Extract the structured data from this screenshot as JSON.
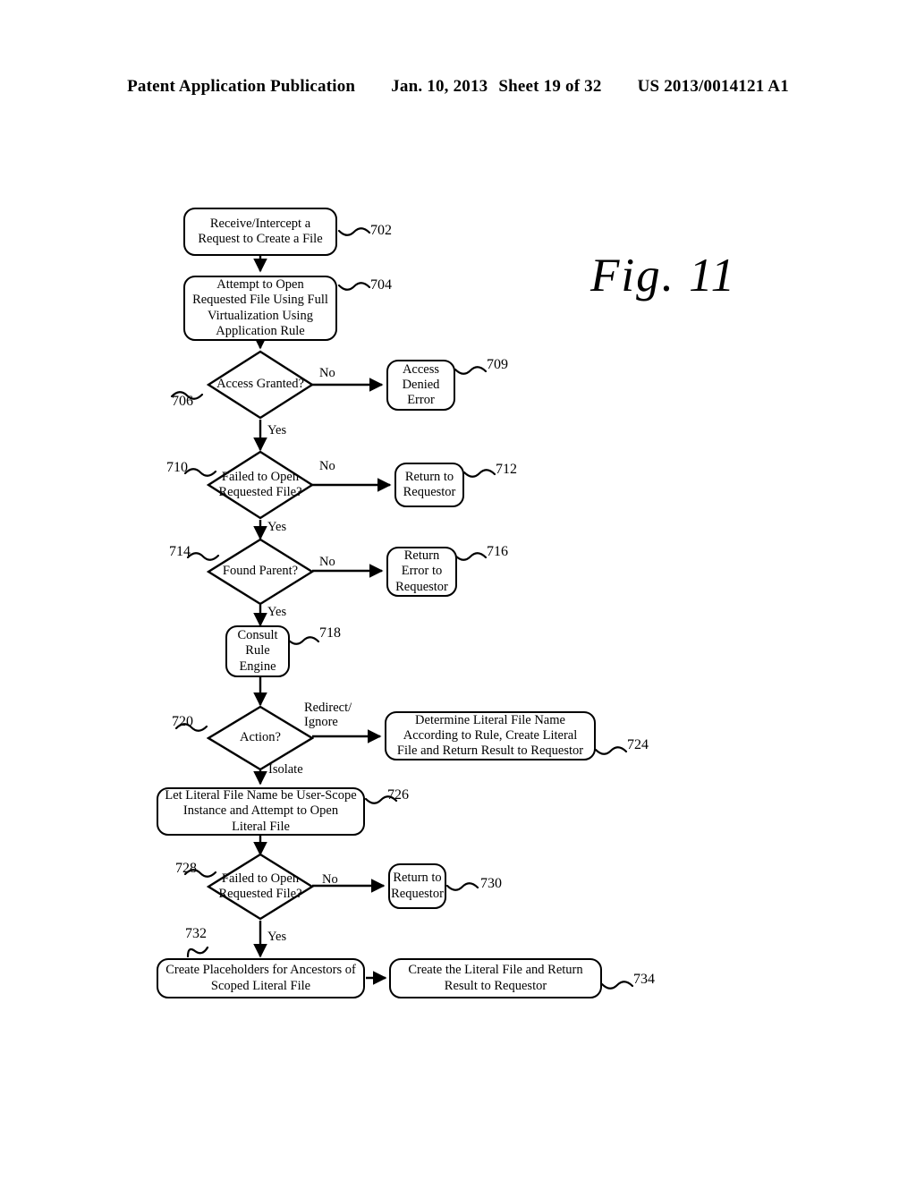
{
  "header": {
    "publication": "Patent Application Publication",
    "date": "Jan. 10, 2013",
    "sheet": "Sheet 19 of 32",
    "number": "US 2013/0014121 A1"
  },
  "figure": {
    "label": "Fig. 11"
  },
  "nodes": {
    "n702": {
      "ref": "702",
      "text": "Receive/Intercept a Request to Create a File",
      "shape": "process"
    },
    "n704": {
      "ref": "704",
      "text": "Attempt to Open Requested File Using Full Virtualization Using Application Rule",
      "shape": "process"
    },
    "n706": {
      "ref": "706",
      "text": "Access Granted?",
      "shape": "decision"
    },
    "n709": {
      "ref": "709",
      "text": "Access Denied Error",
      "shape": "process"
    },
    "n710": {
      "ref": "710",
      "text": "Failed to Open Requested File?",
      "shape": "decision"
    },
    "n712": {
      "ref": "712",
      "text": "Return to Requestor",
      "shape": "process"
    },
    "n714": {
      "ref": "714",
      "text": "Found Parent?",
      "shape": "decision"
    },
    "n716": {
      "ref": "716",
      "text": "Return Error to Requestor",
      "shape": "process"
    },
    "n718": {
      "ref": "718",
      "text": "Consult Rule Engine",
      "shape": "process"
    },
    "n720": {
      "ref": "720",
      "text": "Action?",
      "shape": "decision"
    },
    "n724": {
      "ref": "724",
      "text": "Determine Literal File Name According to Rule, Create Literal File and Return Result to Requestor",
      "shape": "process"
    },
    "n726": {
      "ref": "726",
      "text": "Let Literal File Name be User-Scope Instance and Attempt to Open Literal File",
      "shape": "process"
    },
    "n728": {
      "ref": "728",
      "text": "Failed to Open Requested File?",
      "shape": "decision"
    },
    "n730": {
      "ref": "730",
      "text": "Return to Requestor",
      "shape": "process"
    },
    "n732": {
      "ref": "732",
      "text": "Create Placeholders for Ancestors of Scoped Literal File",
      "shape": "process"
    },
    "n734": {
      "ref": "734",
      "text": "Create the Literal File and Return Result to Requestor",
      "shape": "process"
    }
  },
  "edge_labels": {
    "e706_no": "No",
    "e706_yes": "Yes",
    "e710_no": "No",
    "e710_yes": "Yes",
    "e714_no": "No",
    "e714_yes": "Yes",
    "e720_redirect": "Redirect/\nIgnore",
    "e720_redirect_line1": "Redirect/",
    "e720_redirect_line2": "Ignore",
    "e720_isolate": "Isolate",
    "e728_no": "No",
    "e728_yes": "Yes"
  },
  "colors": {
    "stroke": "#000000",
    "background": "#ffffff"
  }
}
